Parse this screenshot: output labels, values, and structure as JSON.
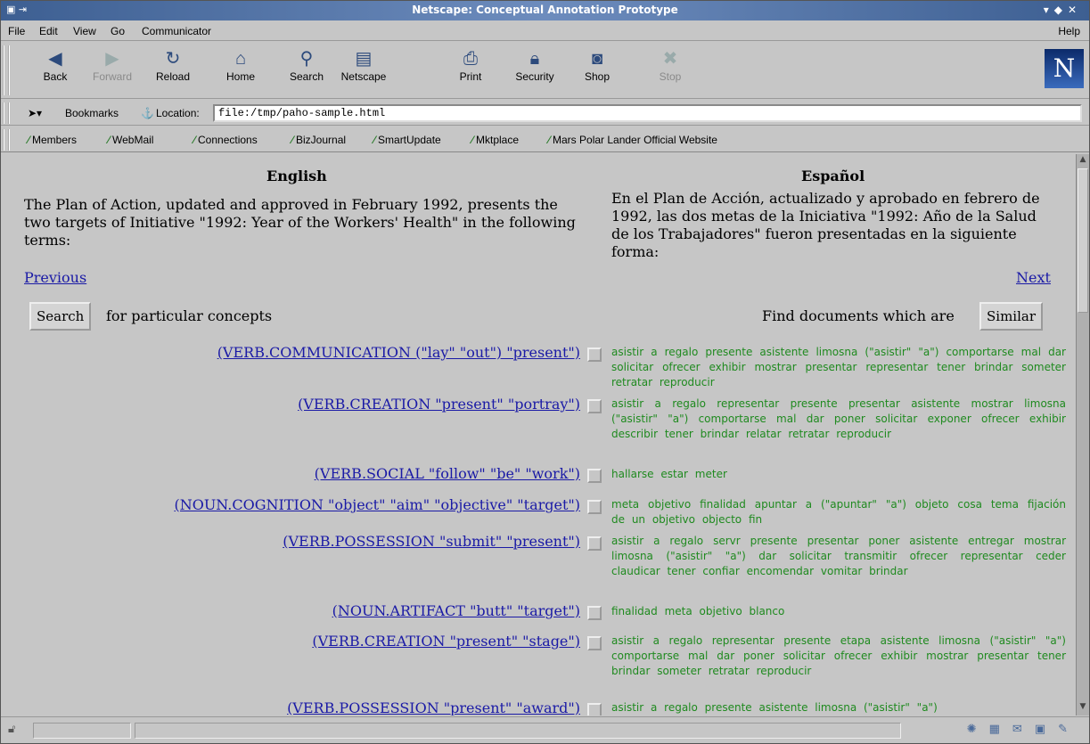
{
  "window": {
    "title": "Netscape: Conceptual Annotation Prototype"
  },
  "menu": [
    "File",
    "Edit",
    "View",
    "Go",
    "Communicator"
  ],
  "menu_help": "Help",
  "toolbar": [
    {
      "label": "Back",
      "icon": "back-arrow-icon",
      "enabled": true
    },
    {
      "label": "Forward",
      "icon": "forward-arrow-icon",
      "enabled": false
    },
    {
      "label": "Reload",
      "icon": "reload-icon",
      "enabled": true
    },
    {
      "label": "Home",
      "icon": "home-icon",
      "enabled": true
    },
    {
      "label": "Search",
      "icon": "search-icon",
      "enabled": true
    },
    {
      "label": "Netscape",
      "icon": "my-netscape-icon",
      "enabled": true
    },
    {
      "label": "Print",
      "icon": "printer-icon",
      "enabled": true
    },
    {
      "label": "Security",
      "icon": "padlock-icon",
      "enabled": true
    },
    {
      "label": "Shop",
      "icon": "shop-icon",
      "enabled": true
    },
    {
      "label": "Stop",
      "icon": "stop-icon",
      "enabled": false
    }
  ],
  "brand_logo": "N",
  "location": {
    "bookmarks_label": "Bookmarks",
    "location_label": "Location:",
    "url": "file:/tmp/paho-sample.html"
  },
  "personal_toolbar": [
    "Members",
    "WebMail",
    "Connections",
    "BizJournal",
    "SmartUpdate",
    "Mktplace",
    "Mars Polar Lander Official Website"
  ],
  "page": {
    "english_header": "English",
    "spanish_header": "Español",
    "english_text": "The Plan of Action, updated and approved in February 1992, presents the two targets of Initiative \"1992: Year of the Workers' Health\" in the following terms:",
    "spanish_text": "En el Plan de Acción, actualizado y aprobado en febrero de 1992, las dos metas de la Iniciativa \"1992: Año de la Salud de los Trabajadores\" fueron presentadas en la siguiente forma:",
    "previous_link": "Previous",
    "next_link": "Next",
    "search_button": "Search",
    "search_suffix": "for particular concepts",
    "find_prefix": "Find documents which are",
    "similar_button": "Similar"
  },
  "concepts": [
    {
      "label": "(VERB.COMMUNICATION (\"lay\" \"out\") \"present\")",
      "words": "asistir a  regalo  presente  asistente  limosna  (\"asistir\" \"a\")  comportarse mal  dar  solicitar  ofrecer  exhibir  mostrar  presentar  representar  tener  brindar  someter  retratar  reproducir"
    },
    {
      "label": "(VERB.CREATION \"present\" \"portray\")",
      "words": "asistir a  regalo  representar  presente  presentar  asistente  mostrar  limosna  (\"asistir\" \"a\")  comportarse mal  dar  poner  solicitar  exponer  ofrecer  exhibir  describir  tener  brindar  relatar  retratar  reproducir"
    },
    {
      "label": "(VERB.SOCIAL \"follow\" \"be\" \"work\")",
      "words": "hallarse  estar  meter"
    },
    {
      "label": "(NOUN.COGNITION \"object\" \"aim\" \"objective\" \"target\")",
      "words": "meta  objetivo  finalidad  apuntar a  (\"apuntar\" \"a\")  objeto  cosa  tema  fijación de un objetivo  objecto  fin"
    },
    {
      "label": "(VERB.POSSESSION \"submit\" \"present\")",
      "words": "asistir a  regalo  servr  presente  presentar  poner  asistente  entregar  mostrar  limosna  (\"asistir\" \"a\")  dar  solicitar  transmitir  ofrecer  representar  ceder  claudicar  tener  confiar  encomendar  vomitar  brindar"
    },
    {
      "label": "(NOUN.ARTIFACT \"butt\" \"target\")",
      "words": "finalidad  meta  objetivo  blanco"
    },
    {
      "label": "(VERB.CREATION \"present\" \"stage\")",
      "words": "asistir a  regalo  representar  presente  etapa  asistente  limosna  (\"asistir\" \"a\")  comportarse mal  dar  poner  solicitar  ofrecer  exhibir  mostrar  presentar  tener  brindar  someter  retratar  reproducir"
    },
    {
      "label": "(VERB.POSSESSION \"present\" \"award\")",
      "words": "asistir a  regalo  presente  asistente  limosna  (\"asistir\" \"a\")"
    }
  ]
}
